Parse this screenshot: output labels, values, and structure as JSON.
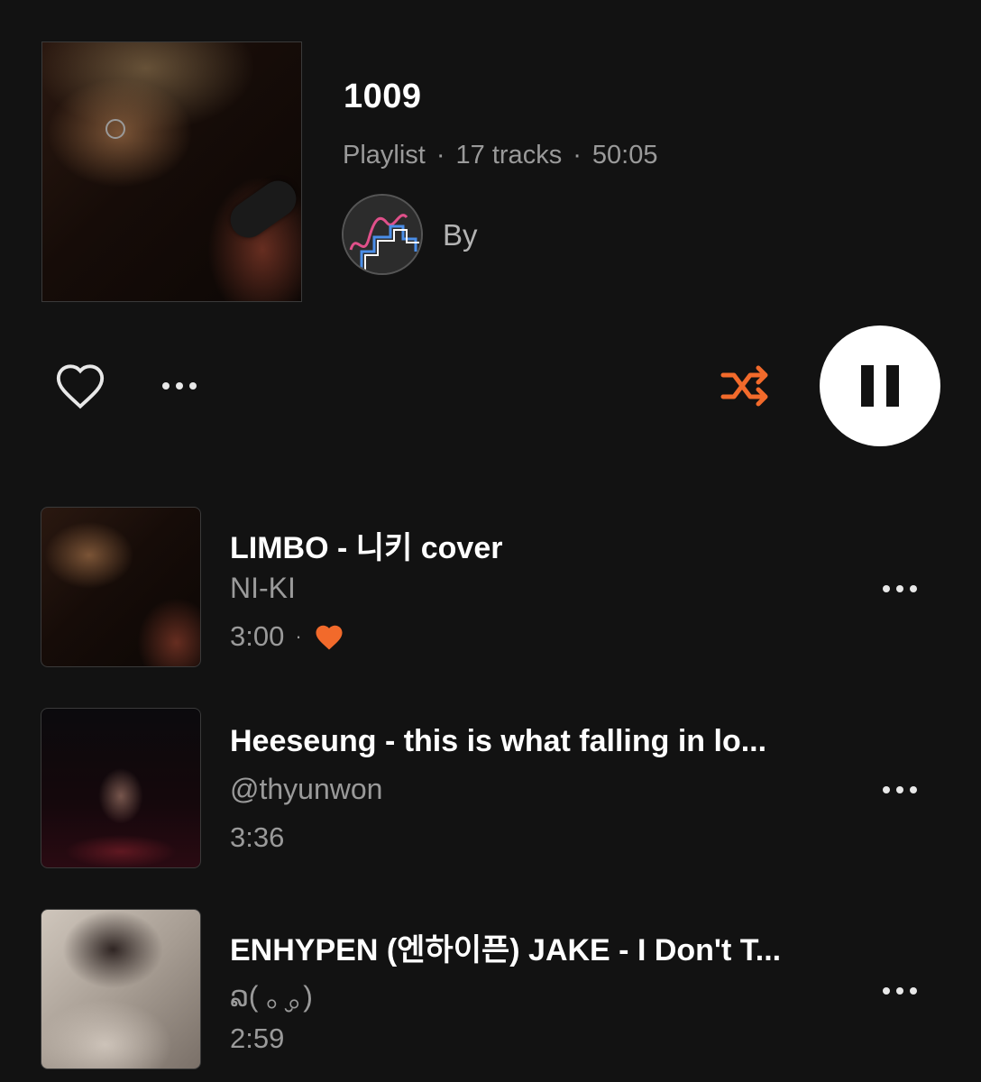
{
  "playlist": {
    "title": "1009",
    "type_label": "Playlist",
    "tracks_label": "17 tracks",
    "duration": "50:05",
    "meta_separator": "·",
    "by_label": "By"
  },
  "icons": {
    "like": "heart-outline-icon",
    "more": "more-dots-icon",
    "shuffle": "shuffle-icon",
    "pause": "pause-icon"
  },
  "colors": {
    "accent": "#f26a2b",
    "background": "#121212",
    "secondary_text": "#9a9a9a"
  },
  "tracks": [
    {
      "title": "LIMBO - 니키 cover",
      "artist": "NI-KI",
      "duration": "3:00",
      "liked": true,
      "separator": "·"
    },
    {
      "title": "Heeseung - this is what falling in lo...",
      "artist": "@thyunwon",
      "duration": "3:36",
      "liked": false
    },
    {
      "title": "ENHYPEN (엔하이픈) JAKE - I Don't T...",
      "artist": "ລ( ｡ ̮｡)",
      "duration": "2:59",
      "liked": false
    }
  ]
}
